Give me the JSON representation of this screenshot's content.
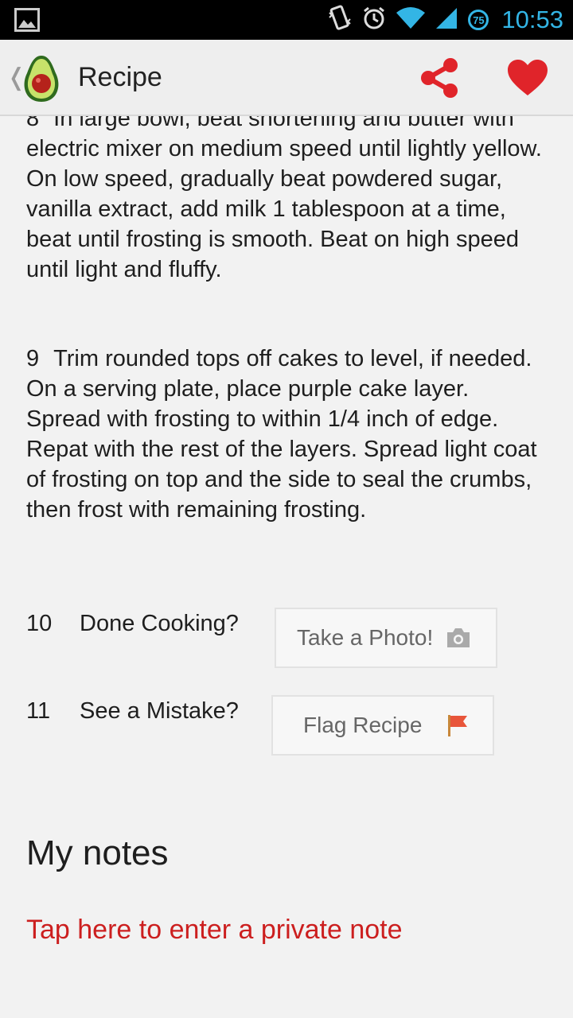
{
  "status_bar": {
    "time": "10:53",
    "battery_level": "75",
    "icons": [
      "gallery-icon",
      "vibrate-icon",
      "alarm-icon",
      "wifi-icon",
      "signal-icon",
      "battery-icon"
    ]
  },
  "action_bar": {
    "title": "Recipe",
    "icons": [
      "back-chevron-icon",
      "avocado-logo-icon",
      "share-icon",
      "heart-icon"
    ],
    "accent_color": "#e0242a"
  },
  "steps": [
    {
      "number": "8",
      "text": "In large bowl, beat shortening and butter with electric mixer on medium speed until lightly yellow. On low speed, gradually beat powdered sugar, vanilla extract,  add milk 1 tablespoon at a time, beat until frosting is smooth. Beat on high speed until light and fluffy."
    },
    {
      "number": "9",
      "text": "Trim rounded tops off cakes to level, if needed. On a serving plate, place purple cake layer. Spread with frosting to within 1/4 inch of edge. Repat with the rest of the layers. Spread light coat of frosting on top and the side to seal the crumbs, then frost with remaining frosting."
    }
  ],
  "actions": [
    {
      "number": "10",
      "label": "Done Cooking?",
      "button": "Take a Photo!",
      "icon": "camera-icon"
    },
    {
      "number": "11",
      "label": "See a Mistake?",
      "button": "Flag Recipe",
      "icon": "flag-icon"
    }
  ],
  "notes": {
    "heading": "My notes",
    "placeholder": "Tap here to enter a private note",
    "link_color": "#cc1f1f"
  }
}
